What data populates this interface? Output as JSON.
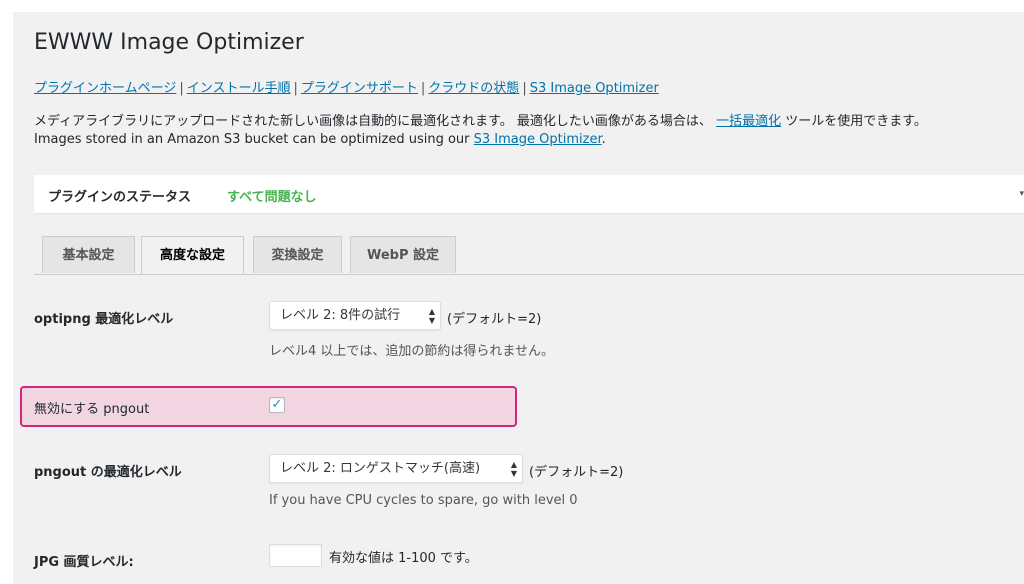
{
  "header": {
    "title": "EWWW Image Optimizer"
  },
  "links": [
    {
      "label": "プラグインホームページ"
    },
    {
      "label": "インストール手順"
    },
    {
      "label": "プラグインサポート"
    },
    {
      "label": "クラウドの状態"
    },
    {
      "label": "S3 Image Optimizer"
    }
  ],
  "link_separator": "|",
  "description": {
    "line1_text": "メディアライブラリにアップロードされた新しい画像は自動的に最適化されます。 最適化したい画像がある場合は、",
    "line1_link": "一括最適化",
    "line1_suffix": "ツールを使用できます。",
    "line2_text": "Images stored in an Amazon S3 bucket can be optimized using our",
    "line2_link": "S3 Image Optimizer",
    "line2_suffix": "."
  },
  "status": {
    "label": "プラグインのステータス",
    "value": "すべて問題なし",
    "value_color": "#46b450"
  },
  "tabs": [
    {
      "label": "基本設定",
      "active": false
    },
    {
      "label": "高度な設定",
      "active": true
    },
    {
      "label": "変換設定",
      "active": false
    },
    {
      "label": "WebP 設定",
      "active": false
    }
  ],
  "settings": {
    "optipng": {
      "label": "optipng 最適化レベル",
      "selected": "レベル 2: 8件の試行",
      "default_note": "(デフォルト=2)",
      "hint": "レベル4 以上では、追加の節約は得られません。"
    },
    "disable_pngout": {
      "label": "無効にする pngout",
      "checked": true,
      "check_glyph": "✓",
      "highlight_color": "#d1267d"
    },
    "pngout_level": {
      "label": "pngout の最適化レベル",
      "selected": "レベル 2: ロンゲストマッチ(高速)",
      "default_note": "(デフォルト=2)",
      "hint": "If you have CPU cycles to spare, go with level 0"
    },
    "jpg_quality": {
      "label": "JPG 画質レベル:",
      "value": "",
      "note": "有効な値は 1-100 です。"
    }
  },
  "icons": {
    "select_arrow_up": "▲",
    "select_arrow_down": "▼",
    "edge_arrow": "▾"
  },
  "colors": {
    "link": "#0073aa",
    "background": "#f1f1f1"
  }
}
